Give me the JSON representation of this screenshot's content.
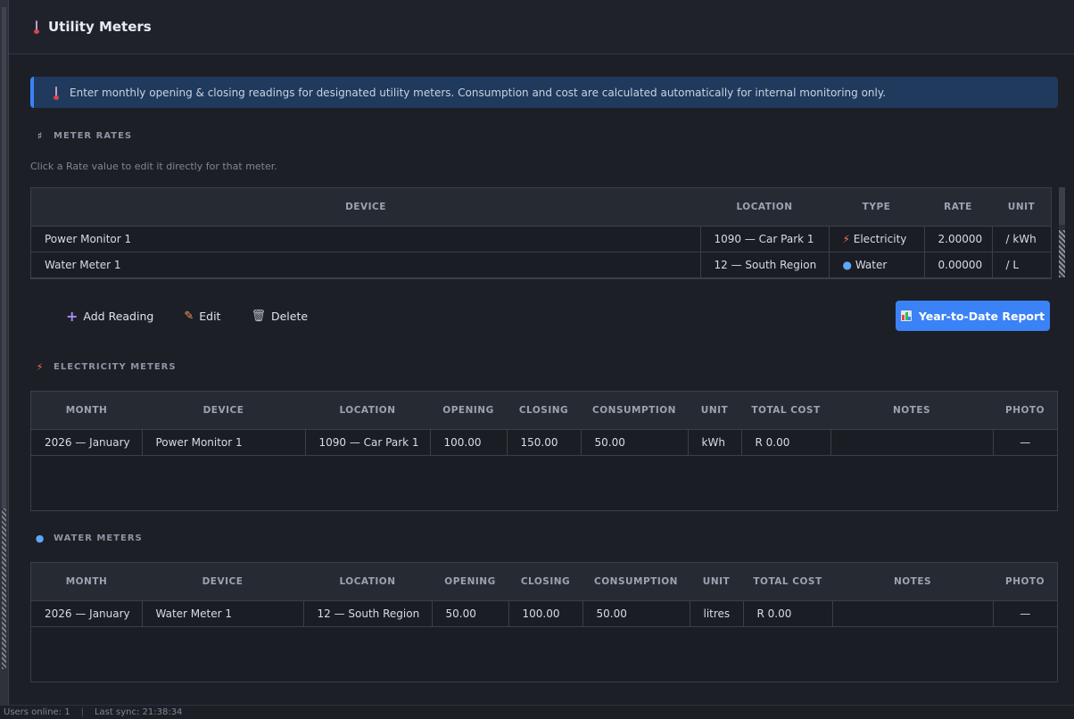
{
  "header": {
    "title": "Utility Meters",
    "icon": "thermometer-icon"
  },
  "info": {
    "text": "Enter monthly opening & closing readings for designated utility meters.  Consumption and cost are calculated automatically for internal monitoring only."
  },
  "rates": {
    "section_title": "METER RATES",
    "hint": "Click a Rate value to edit it directly for that meter.",
    "columns": [
      "DEVICE",
      "LOCATION",
      "TYPE",
      "RATE",
      "UNIT"
    ],
    "rows": [
      {
        "device": "Power Monitor 1",
        "location": "1090 — Car Park 1",
        "type": "Electricity",
        "type_icon": "lightning-icon",
        "rate": "2.00000",
        "unit": "/ kWh"
      },
      {
        "device": "Water Meter 1",
        "location": "12 — South Region",
        "type": "Water",
        "type_icon": "droplet-icon",
        "rate": "0.00000",
        "unit": "/ L"
      }
    ]
  },
  "toolbar": {
    "add_label": "Add Reading",
    "edit_label": "Edit",
    "delete_label": "Delete",
    "report_label": "Year-to-Date Report"
  },
  "electricity": {
    "section_title": "ELECTRICITY METERS",
    "columns": [
      "MONTH",
      "DEVICE",
      "LOCATION",
      "OPENING",
      "CLOSING",
      "CONSUMPTION",
      "UNIT",
      "TOTAL COST",
      "NOTES",
      "PHOTO"
    ],
    "rows": [
      {
        "month": "2026 — January",
        "device": "Power Monitor 1",
        "location": "1090 — Car Park 1",
        "opening": "100.00",
        "closing": "150.00",
        "consumption": "50.00",
        "unit": "kWh",
        "total_cost": "R 0.00",
        "notes": "",
        "photo": "—"
      }
    ]
  },
  "water": {
    "section_title": "WATER METERS",
    "columns": [
      "MONTH",
      "DEVICE",
      "LOCATION",
      "OPENING",
      "CLOSING",
      "CONSUMPTION",
      "UNIT",
      "TOTAL COST",
      "NOTES",
      "PHOTO"
    ],
    "rows": [
      {
        "month": "2026 — January",
        "device": "Water Meter 1",
        "location": "12 — South Region",
        "opening": "50.00",
        "closing": "100.00",
        "consumption": "50.00",
        "unit": "litres",
        "total_cost": "R 0.00",
        "notes": "",
        "photo": "—"
      }
    ]
  },
  "status": {
    "users": "Users online: 1",
    "sync": "Last sync: 21:38:34"
  },
  "colors": {
    "accent": "#3b82f6",
    "background": "#1c1f26",
    "info_bg": "#1f3a5c",
    "electricity": "#f97352",
    "water": "#60a5fa"
  }
}
